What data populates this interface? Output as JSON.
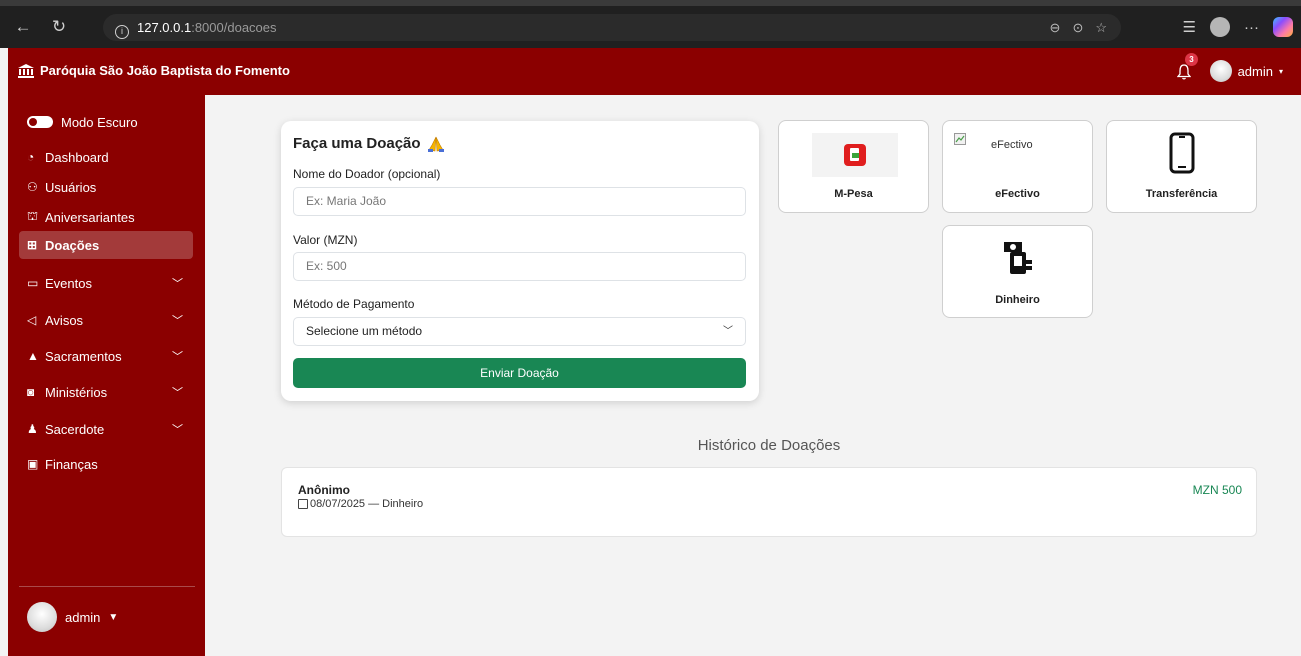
{
  "browser": {
    "url_host": "127.0.0.1",
    "url_path": ":8000/doacoes"
  },
  "navbar": {
    "brand": "Paróquia São João Baptista do Fomento",
    "notifications_count": "3",
    "user_label": "admin"
  },
  "sidebar": {
    "items": [
      {
        "label": "Modo Escuro",
        "icon": "toggle-icon"
      },
      {
        "label": "Dashboard",
        "icon": "dashboard-icon"
      },
      {
        "label": "Usuários",
        "icon": "users-icon"
      },
      {
        "label": "Aniversariantes",
        "icon": "cake-icon"
      },
      {
        "label": "Doações",
        "icon": "gift-icon",
        "active": true
      },
      {
        "label": "Eventos",
        "icon": "calendar-icon",
        "expandable": true
      },
      {
        "label": "Avisos",
        "icon": "megaphone-icon",
        "expandable": true
      },
      {
        "label": "Sacramentos",
        "icon": "drop-icon",
        "expandable": true
      },
      {
        "label": "Ministérios",
        "icon": "book-icon",
        "expandable": true
      },
      {
        "label": "Sacerdote",
        "icon": "priest-icon",
        "expandable": true
      },
      {
        "label": "Finanças",
        "icon": "money-icon"
      }
    ],
    "user_label": "admin"
  },
  "donation_form": {
    "title": "Faça uma Doação",
    "donor_label": "Nome do Doador (opcional)",
    "donor_placeholder": "Ex: Maria João",
    "amount_label": "Valor (MZN)",
    "amount_placeholder": "Ex: 500",
    "method_label": "Método de Pagamento",
    "method_selected": "Selecione um método",
    "submit_label": "Enviar Doação"
  },
  "payment_methods": [
    {
      "label": "M-Pesa",
      "icon": "mpesa-icon"
    },
    {
      "label": "eFectivo",
      "icon": "broken-image-icon",
      "alt": "eFectivo"
    },
    {
      "label": "Transferência",
      "icon": "phone-icon"
    },
    {
      "label": "Dinheiro",
      "icon": "cash-icon"
    }
  ],
  "history": {
    "title": "Histórico de Doações",
    "entries": [
      {
        "name": "Anônimo",
        "date": "08/07/2025",
        "method": "Dinheiro",
        "meta": "08/07/2025 — Dinheiro",
        "amount": "MZN 500"
      }
    ]
  },
  "colors": {
    "brand": "#8b0000",
    "success": "#198754"
  }
}
